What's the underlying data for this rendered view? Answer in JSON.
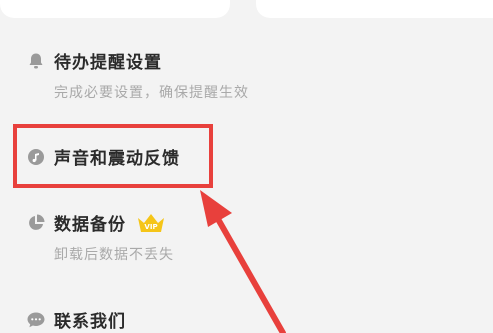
{
  "settings": {
    "reminder": {
      "title": "待办提醒设置",
      "subtitle": "完成必要设置，确保提醒生效",
      "icon": "bell-icon"
    },
    "sound": {
      "title": "声音和震动反馈",
      "icon": "sound-icon"
    },
    "backup": {
      "title": "数据备份",
      "subtitle": "卸载后数据不丢失",
      "icon": "pie-chart-icon",
      "badge": "VIP"
    },
    "contact": {
      "title": "联系我们",
      "icon": "chat-bubble-icon"
    }
  },
  "colors": {
    "highlight": "#e8403c",
    "vip_gold": "#f5c518"
  }
}
